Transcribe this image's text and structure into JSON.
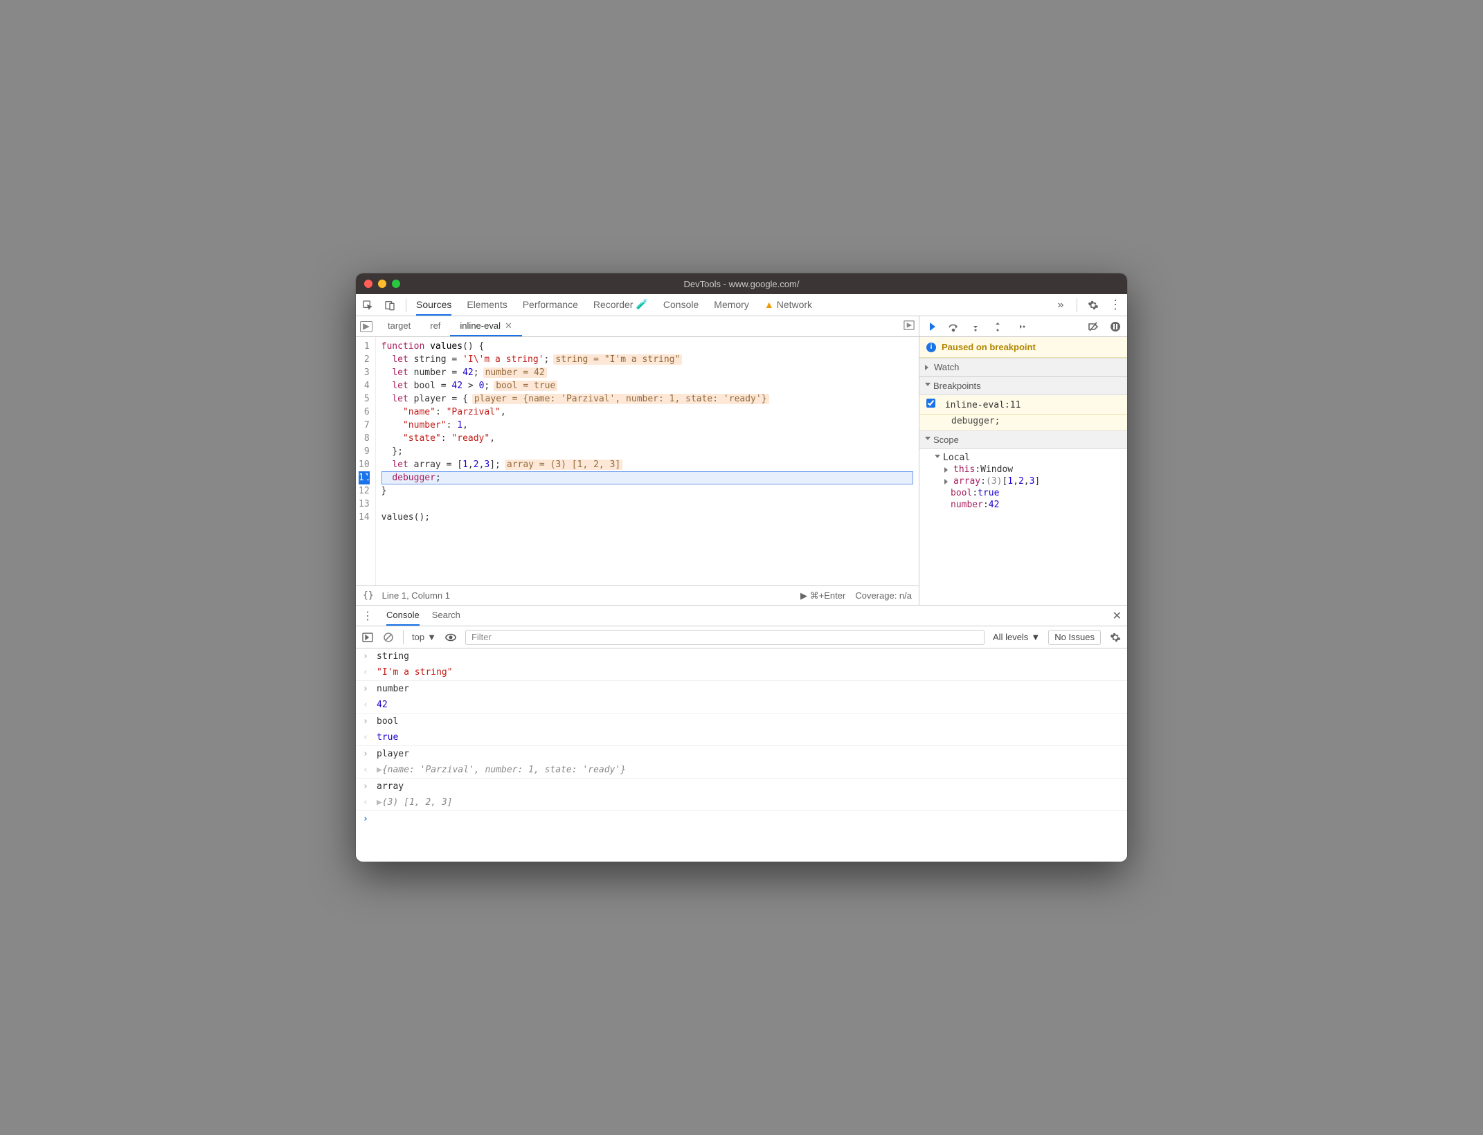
{
  "titlebar": {
    "title": "DevTools - www.google.com/"
  },
  "toolbar": {
    "tabs": [
      "Sources",
      "Elements",
      "Performance",
      "Recorder",
      "Console",
      "Memory",
      "Network"
    ],
    "active": "Sources",
    "warn_tab": "Network"
  },
  "filetabs": {
    "items": [
      {
        "label": "target",
        "active": false,
        "closeable": false
      },
      {
        "label": "ref",
        "active": false,
        "closeable": false
      },
      {
        "label": "inline-eval",
        "active": true,
        "closeable": true
      }
    ]
  },
  "code": {
    "lines": [
      {
        "n": 1,
        "html": "<span class='kw'>function</span> <span class='fn'>values</span>() {"
      },
      {
        "n": 2,
        "html": "  <span class='kw'>let</span> string = <span class='str'>'I\\'m a string'</span>;",
        "inline": "string = \"I'm a string\""
      },
      {
        "n": 3,
        "html": "  <span class='kw'>let</span> number = <span class='num'>42</span>;",
        "inline": "number = 42"
      },
      {
        "n": 4,
        "html": "  <span class='kw'>let</span> bool = <span class='num'>42</span> > <span class='num'>0</span>;",
        "inline": "bool = true"
      },
      {
        "n": 5,
        "html": "  <span class='kw'>let</span> player = {",
        "inline": "player = {name: 'Parzival', number: 1, state: 'ready'}"
      },
      {
        "n": 6,
        "html": "    <span class='prop'>\"name\"</span>: <span class='str'>\"Parzival\"</span>,"
      },
      {
        "n": 7,
        "html": "    <span class='prop'>\"number\"</span>: <span class='num'>1</span>,"
      },
      {
        "n": 8,
        "html": "    <span class='prop'>\"state\"</span>: <span class='str'>\"ready\"</span>,"
      },
      {
        "n": 9,
        "html": "  };"
      },
      {
        "n": 10,
        "html": "  <span class='kw'>let</span> array = [<span class='num'>1</span>,<span class='num'>2</span>,<span class='num'>3</span>];",
        "inline": "array = (3) [1, 2, 3]"
      },
      {
        "n": 11,
        "html": "  <span class='kw'>debugger</span>;",
        "exec": true
      },
      {
        "n": 12,
        "html": "}"
      },
      {
        "n": 13,
        "html": ""
      },
      {
        "n": 14,
        "html": "values();"
      }
    ]
  },
  "editor_status": {
    "braces": "{}",
    "pos": "Line 1, Column 1",
    "run": "▶ ⌘+Enter",
    "coverage": "Coverage: n/a"
  },
  "debugger": {
    "paused": "Paused on breakpoint",
    "sections": {
      "watch": "Watch",
      "breakpoints": "Breakpoints",
      "scope": "Scope"
    },
    "bp": {
      "label": "inline-eval:11",
      "snippet": "debugger;"
    },
    "scope_local": "Local",
    "scope_rows": [
      {
        "k": "this",
        "v": "Window",
        "expandable": true
      },
      {
        "k": "array",
        "v": "(3) [1, 2, 3]",
        "expandable": true,
        "colorbrk": true
      },
      {
        "k": "bool",
        "v": "true"
      },
      {
        "k": "number",
        "v": "42"
      }
    ]
  },
  "drawer": {
    "tabs": [
      "Console",
      "Search"
    ],
    "active": "Console"
  },
  "console_toolbar": {
    "context": "top",
    "filter_placeholder": "Filter",
    "levels": "All levels",
    "issues": "No Issues"
  },
  "console": [
    {
      "dir": "in",
      "text": "string"
    },
    {
      "dir": "out",
      "html": "<span class='cstr'>\"I'm a string\"</span>"
    },
    {
      "dir": "in",
      "text": "number"
    },
    {
      "dir": "out",
      "html": "<span class='cnum'>42</span>"
    },
    {
      "dir": "in",
      "text": "bool"
    },
    {
      "dir": "out",
      "html": "<span class='ckw'>true</span>"
    },
    {
      "dir": "in",
      "text": "player"
    },
    {
      "dir": "out",
      "html": "<span class='car'>▶</span><span class='cobj'>{name: 'Parzival', number: 1, state: 'ready'}</span>",
      "expandable": true
    },
    {
      "dir": "in",
      "text": "array"
    },
    {
      "dir": "out",
      "html": "<span class='car'>▶</span><span class='cobj'>(3) [1, 2, 3]</span>",
      "expandable": true
    }
  ]
}
